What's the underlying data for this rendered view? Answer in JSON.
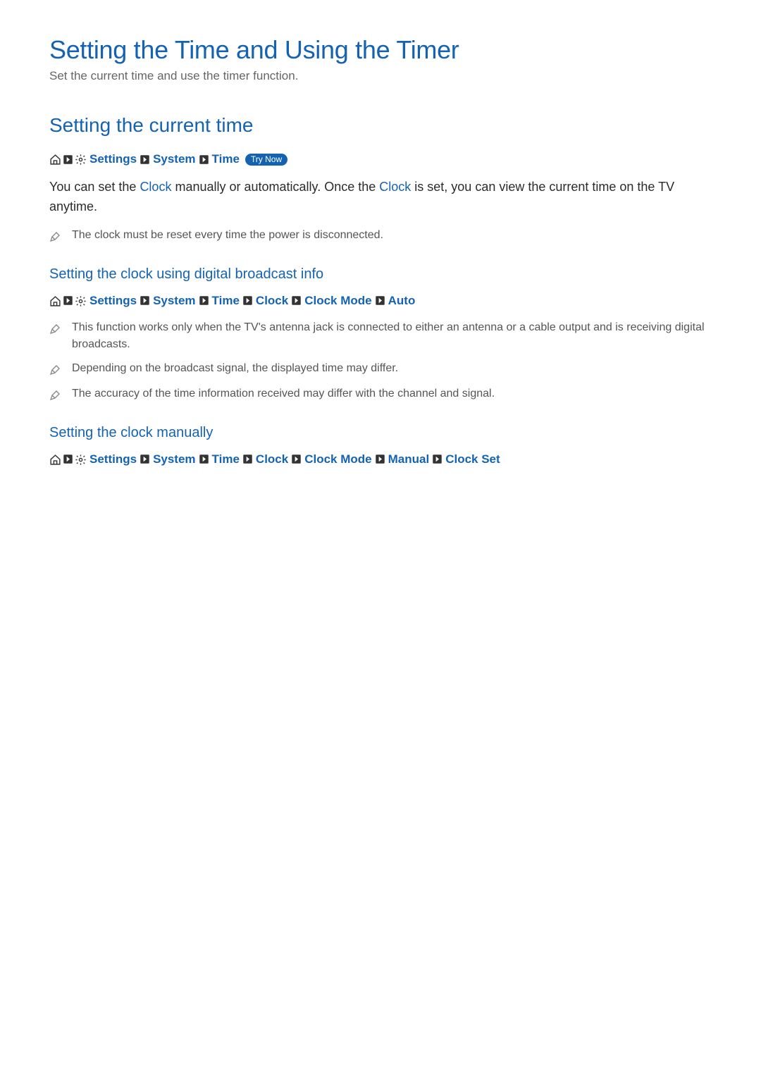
{
  "page": {
    "title": "Setting the Time and Using the Timer",
    "subtitle": "Set the current time and use the timer function."
  },
  "section1": {
    "heading": "Setting the current time",
    "breadcrumb": {
      "settings": "Settings",
      "system": "System",
      "time": "Time",
      "try_now": "Try Now"
    },
    "body_parts": {
      "p1": "You can set the ",
      "clock1": "Clock",
      "p2": " manually or automatically. Once the ",
      "clock2": "Clock",
      "p3": " is set, you can view the current time on the TV anytime."
    },
    "notes": [
      "The clock must be reset every time the power is disconnected."
    ]
  },
  "section2": {
    "heading": "Setting the clock using digital broadcast info",
    "breadcrumb": {
      "settings": "Settings",
      "system": "System",
      "time": "Time",
      "clock": "Clock",
      "clock_mode": "Clock Mode",
      "auto": "Auto"
    },
    "notes": [
      "This function works only when the TV's antenna jack is connected to either an antenna or a cable output and is receiving digital broadcasts.",
      "Depending on the broadcast signal, the displayed time may differ.",
      "The accuracy of the time information received may differ with the channel and signal."
    ]
  },
  "section3": {
    "heading": "Setting the clock manually",
    "breadcrumb": {
      "settings": "Settings",
      "system": "System",
      "time": "Time",
      "clock": "Clock",
      "clock_mode": "Clock Mode",
      "manual": "Manual",
      "clock_set": "Clock Set"
    }
  }
}
